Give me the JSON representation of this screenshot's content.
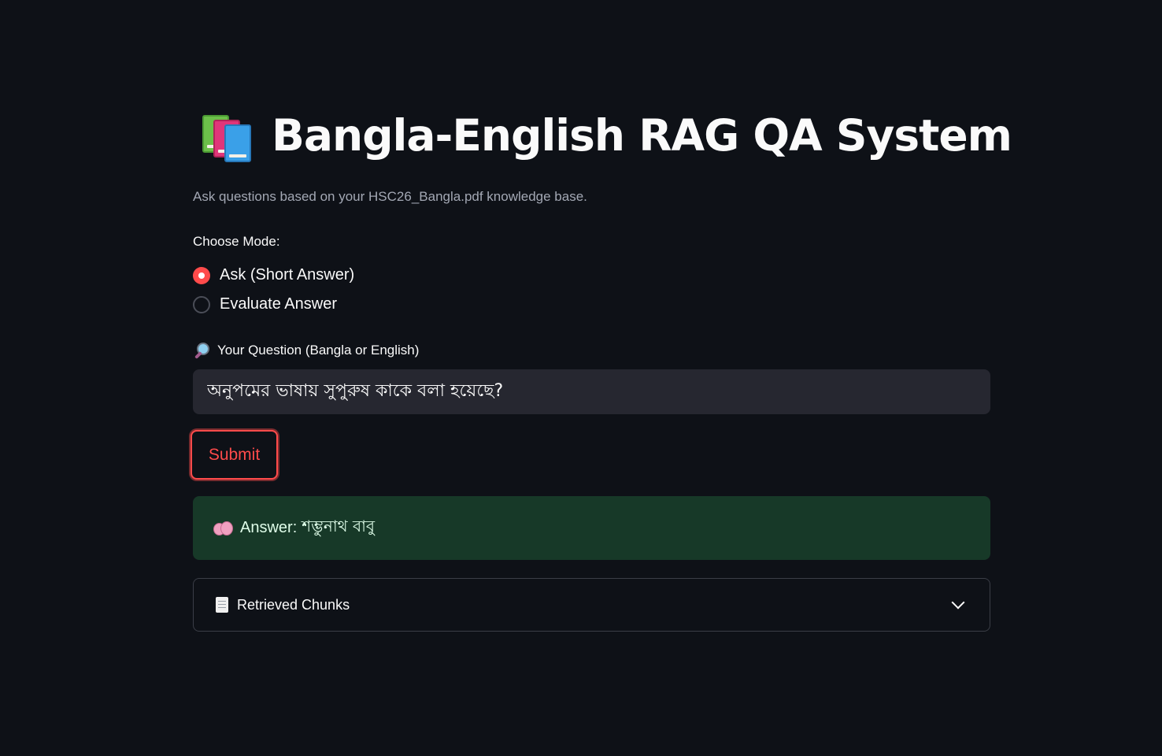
{
  "header": {
    "title": "Bangla-English RAG QA System",
    "title_icon": "books-icon",
    "subtitle": "Ask questions based on your HSC26_Bangla.pdf knowledge base."
  },
  "mode": {
    "label": "Choose Mode:",
    "options": [
      {
        "label": "Ask (Short Answer)",
        "selected": true
      },
      {
        "label": "Evaluate Answer",
        "selected": false
      }
    ]
  },
  "question": {
    "label": "Your Question (Bangla or English)",
    "icon": "magnifying-glass-icon",
    "value": "অনুপমের ভাষায় সুপুরুষ কাকে বলা হয়েছে?"
  },
  "submit": {
    "label": "Submit"
  },
  "answer": {
    "icon": "brain-icon",
    "prefix": "Answer:",
    "text": "শম্ভুনাথ বাবু"
  },
  "expander": {
    "icon": "document-icon",
    "label": "Retrieved Chunks",
    "expanded": false
  },
  "colors": {
    "background": "#0e1117",
    "accent": "#ff4b4b",
    "input_bg": "#262730",
    "success_bg": "#173928",
    "success_text": "#dffde9"
  }
}
